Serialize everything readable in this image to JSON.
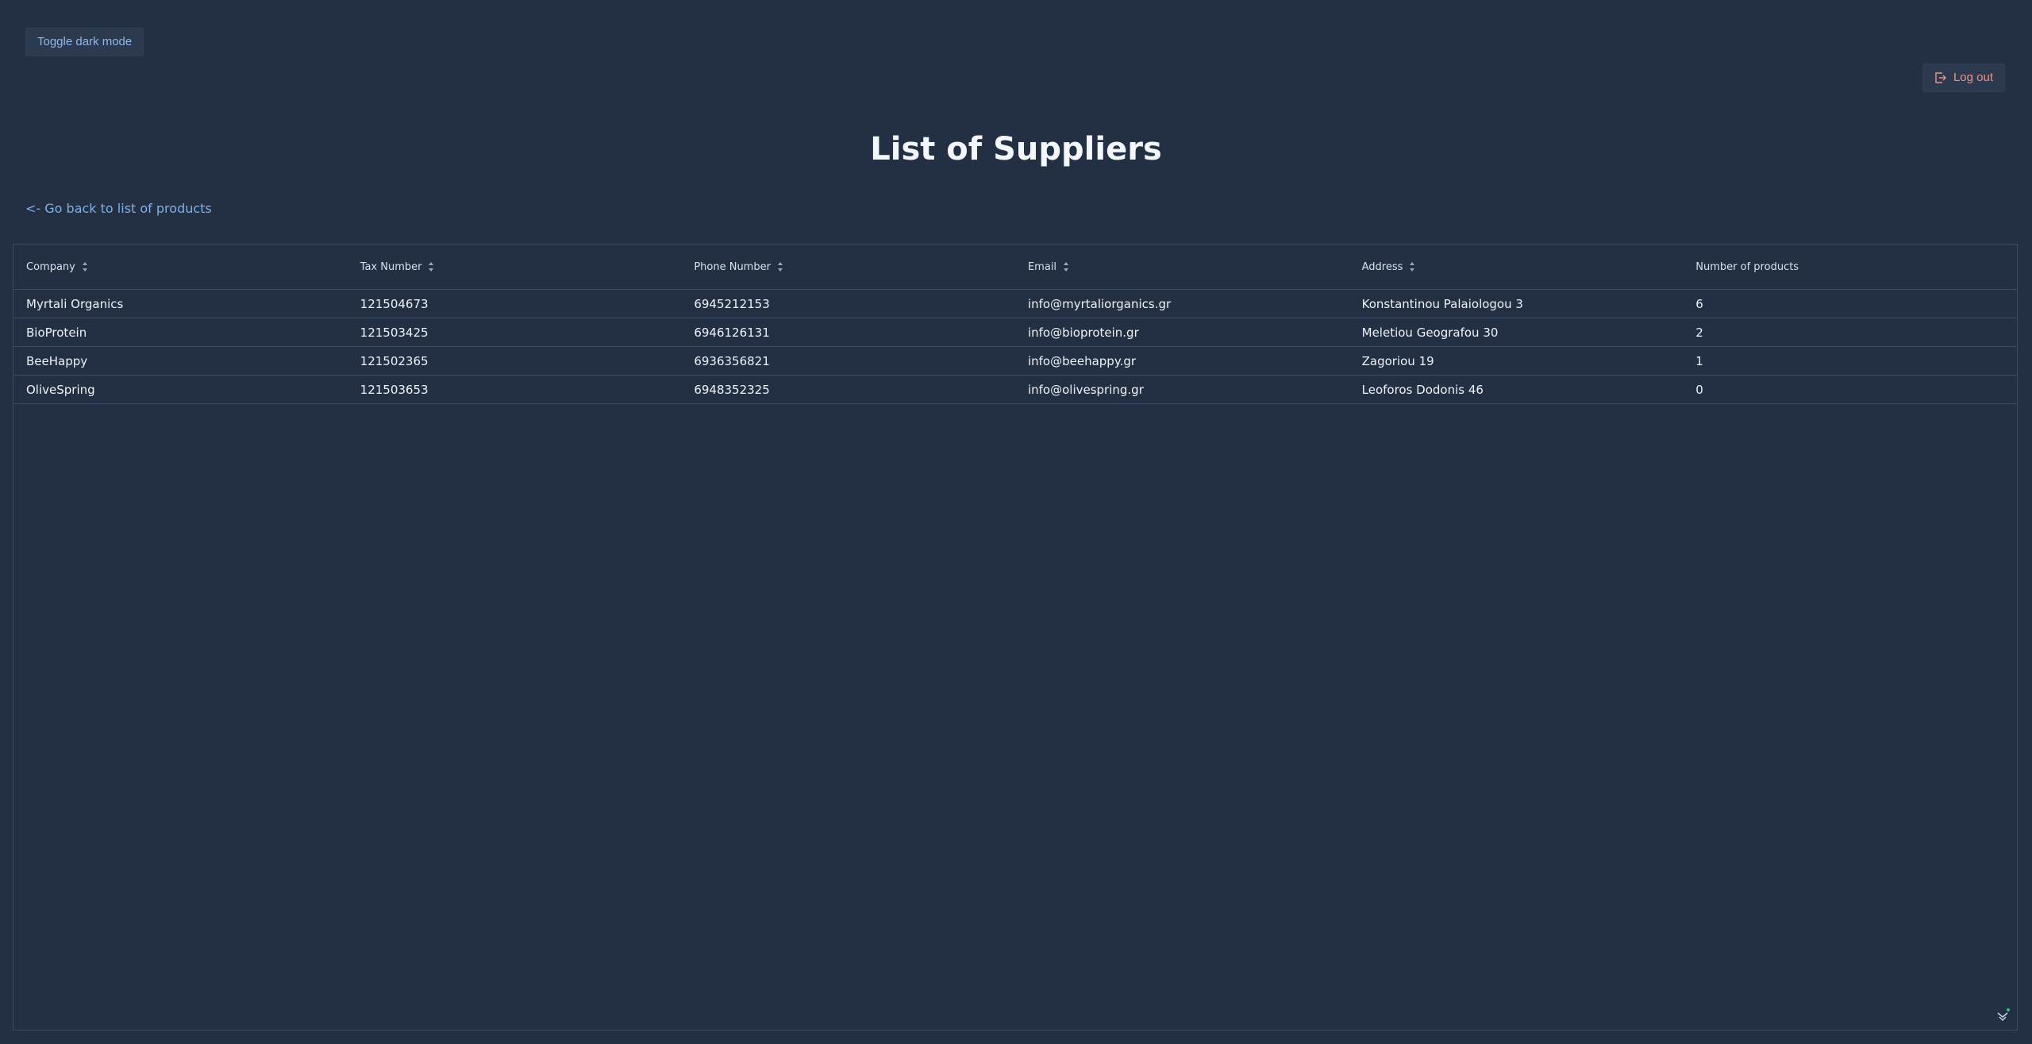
{
  "header": {
    "toggle_dark_mode_label": "Toggle dark mode",
    "logout_label": "Log out",
    "logout_color": "#e6958a"
  },
  "main": {
    "title": "List of Suppliers",
    "back_link": "<- Go back to list of products"
  },
  "table": {
    "columns": [
      {
        "label": "Company",
        "sortable": true
      },
      {
        "label": "Tax Number",
        "sortable": true
      },
      {
        "label": "Phone Number",
        "sortable": true
      },
      {
        "label": "Email",
        "sortable": true
      },
      {
        "label": "Address",
        "sortable": true
      },
      {
        "label": "Number of products",
        "sortable": false
      }
    ],
    "rows": [
      {
        "company": "Myrtali Organics",
        "tax_number": "121504673",
        "phone": "6945212153",
        "email": "info@myrtaliorganics.gr",
        "address": "Konstantinou Palaiologou 3",
        "num_products": "6"
      },
      {
        "company": "BioProtein",
        "tax_number": "121503425",
        "phone": "6946126131",
        "email": "info@bioprotein.gr",
        "address": "Meletiou Geografou 30",
        "num_products": "2"
      },
      {
        "company": "BeeHappy",
        "tax_number": "121502365",
        "phone": "6936356821",
        "email": "info@beehappy.gr",
        "address": "Zagoriou 19",
        "num_products": "1"
      },
      {
        "company": "OliveSpring",
        "tax_number": "121503653",
        "phone": "6948352325",
        "email": "info@olivespring.gr",
        "address": "Leoforos Dodonis 46",
        "num_products": "0"
      }
    ]
  },
  "colors": {
    "background": "#233044",
    "link": "#7fb0e6",
    "border": "#3a4a61"
  }
}
